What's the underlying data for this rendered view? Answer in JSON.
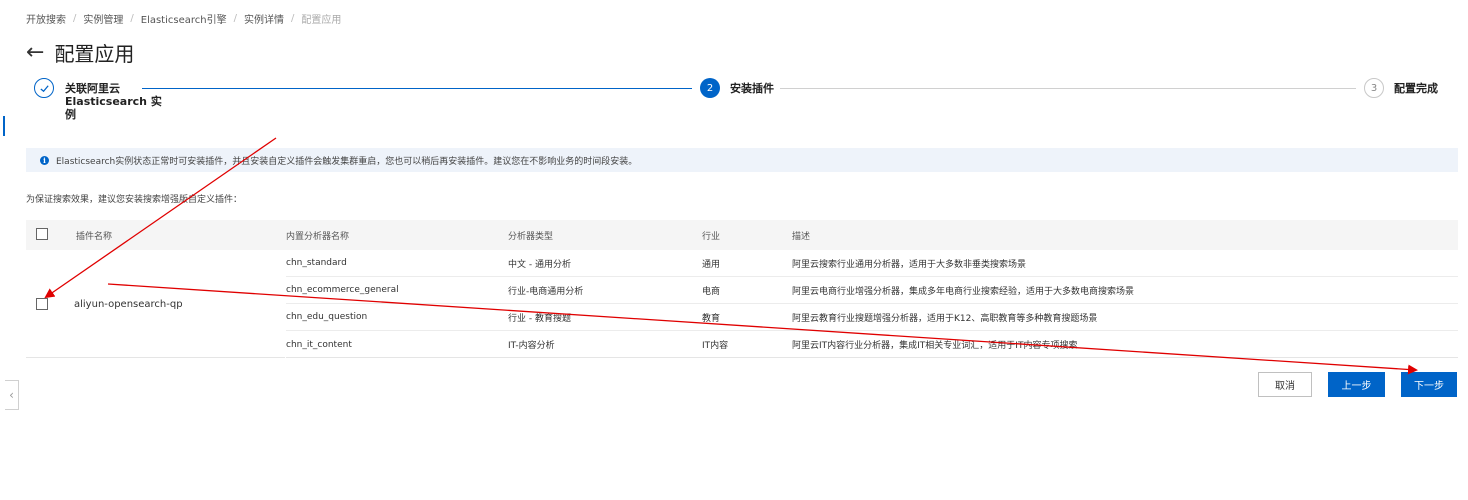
{
  "breadcrumb": [
    "开放搜索",
    "实例管理",
    "Elasticsearch引擎",
    "实例详情",
    "配置应用"
  ],
  "page_title": "配置应用",
  "steps": [
    {
      "number": "1",
      "icon": "check-icon",
      "label": "关联阿里云 Elasticsearch 实例",
      "status": "done"
    },
    {
      "number": "2",
      "label": "安装插件",
      "status": "active"
    },
    {
      "number": "3",
      "label": "配置完成",
      "status": "pending"
    }
  ],
  "notice": "Elasticsearch实例状态正常时可安装插件，并且安装自定义插件会触发集群重启，您也可以稍后再安装插件。建议您在不影响业务的时间段安装。",
  "hint": "为保证搜索效果，建议您安装搜索增强版自定义插件：",
  "table": {
    "headers": [
      "插件名称",
      "内置分析器名称",
      "分析器类型",
      "行业",
      "描述"
    ],
    "plugin_name": "aliyun-opensearch-qp",
    "rows": [
      {
        "analyzer": "chn_standard",
        "type": "中文 - 通用分析",
        "industry": "通用",
        "desc": "阿里云搜索行业通用分析器，适用于大多数非垂类搜索场景"
      },
      {
        "analyzer": "chn_ecommerce_general",
        "type": "行业-电商通用分析",
        "industry": "电商",
        "desc": "阿里云电商行业增强分析器，集成多年电商行业搜索经验，适用于大多数电商搜索场景"
      },
      {
        "analyzer": "chn_edu_question",
        "type": "行业 - 教育搜题",
        "industry": "教育",
        "desc": "阿里云教育行业搜题增强分析器，适用于K12、高职教育等多种教育搜题场景"
      },
      {
        "analyzer": "chn_it_content",
        "type": "IT-内容分析",
        "industry": "IT内容",
        "desc": "阿里云IT内容行业分析器，集成IT相关专业词汇，适用于IT内容专项搜索"
      }
    ]
  },
  "buttons": {
    "cancel": "取消",
    "prev": "上一步",
    "next": "下一步"
  },
  "colors": {
    "primary": "#0064c8",
    "annotation": "#e00000"
  }
}
